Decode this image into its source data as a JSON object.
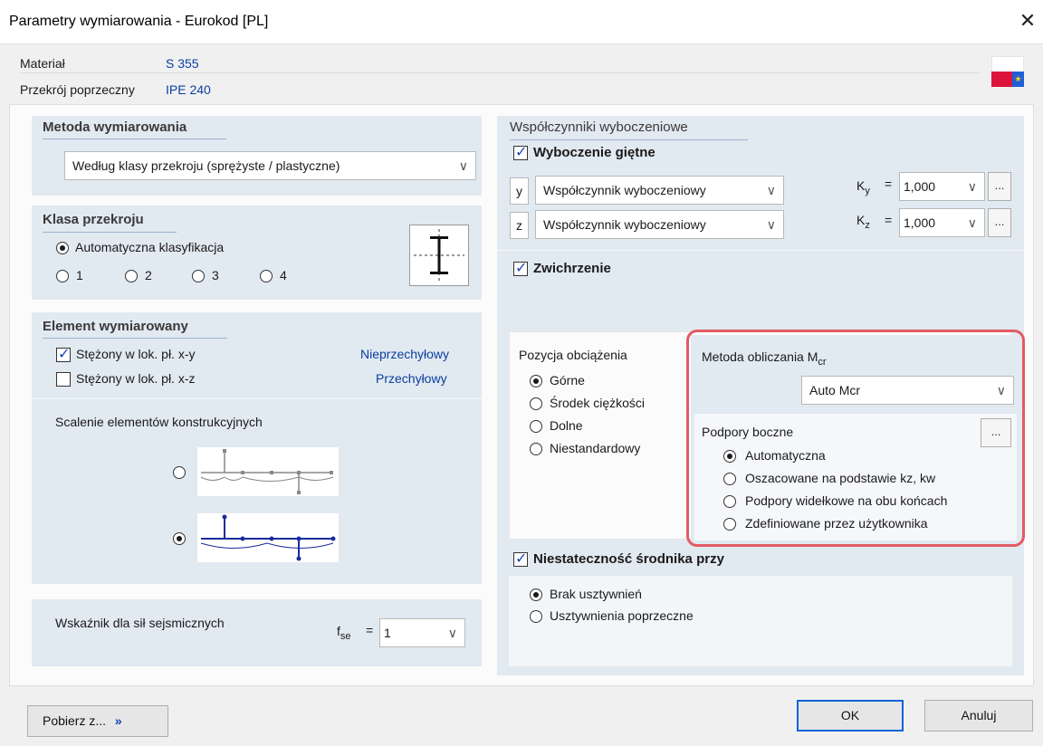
{
  "window": {
    "title": "Parametry wymiarowania - Eurokod [PL]",
    "close_glyph": "✕"
  },
  "header": {
    "material_label": "Materiał",
    "material_value": "S 355",
    "section_label": "Przekrój poprzeczny",
    "section_value": "IPE 240",
    "flag_icon": "pl-eu-flag-icon"
  },
  "method": {
    "title": "Metoda wymiarowania",
    "selected": "Według klasy przekroju (sprężyste / plastyczne)"
  },
  "cross_class": {
    "title": "Klasa przekroju",
    "auto_label": "Automatyczna klasyfikacja",
    "options": [
      "1",
      "2",
      "3",
      "4"
    ],
    "auto_selected": true
  },
  "element": {
    "title": "Element wymiarowany",
    "braced_xy_label": "Stężony w lok. pł. x-y",
    "braced_xy_checked": true,
    "braced_xy_status": "Nieprzechyłowy",
    "braced_xz_label": "Stężony w lok. pł. x-z",
    "braced_xz_checked": false,
    "braced_xz_status": "Przechyłowy",
    "merge_label": "Scalenie elementów konstrukcyjnych",
    "merge_selected": 2
  },
  "seismic": {
    "label": "Wskaźnik dla sił sejsmicznych",
    "symbol_main": "f",
    "symbol_sub": "se",
    "eq": "=",
    "value": "1"
  },
  "buckling": {
    "title": "Współczynniki wyboczeniowe",
    "flexural_label": "Wyboczenie giętne",
    "flexural_checked": true,
    "y_axis": "y",
    "z_axis": "z",
    "y_combo": "Współczynnik wyboczeniowy",
    "z_combo": "Współczynnik wyboczeniowy",
    "ky_main": "K",
    "ky_sub": "y",
    "kz_main": "K",
    "kz_sub": "z",
    "eq": "=",
    "ky_value": "1,000",
    "kz_value": "1,000",
    "dots": "..."
  },
  "lateral": {
    "label": "Zwichrzenie",
    "checked": true
  },
  "load_position": {
    "title": "Pozycja obciążenia",
    "options": [
      "Górne",
      "Środek ciężkości",
      "Dolne",
      "Niestandardowy"
    ],
    "selected": 0
  },
  "mcr": {
    "title_main": "Metoda obliczania M",
    "title_sub": "cr",
    "selected": "Auto Mcr",
    "supports_title": "Podpory boczne",
    "dots": "...",
    "supports_options": [
      "Automatyczna",
      "Oszacowane na podstawie kz, kw",
      "Podpory widełkowe na obu końcach",
      "Zdefiniowane przez użytkownika"
    ],
    "supports_selected": 0,
    "highlight_color": "#e35a63"
  },
  "web": {
    "label": "Niestateczność środnika przy",
    "checked": true,
    "options": [
      "Brak usztywnień",
      "Usztywnienia poprzeczne"
    ],
    "selected": 0
  },
  "footer": {
    "import_label": "Pobierz z...",
    "import_glyph": "»",
    "ok_label": "OK",
    "cancel_label": "Anuluj"
  }
}
